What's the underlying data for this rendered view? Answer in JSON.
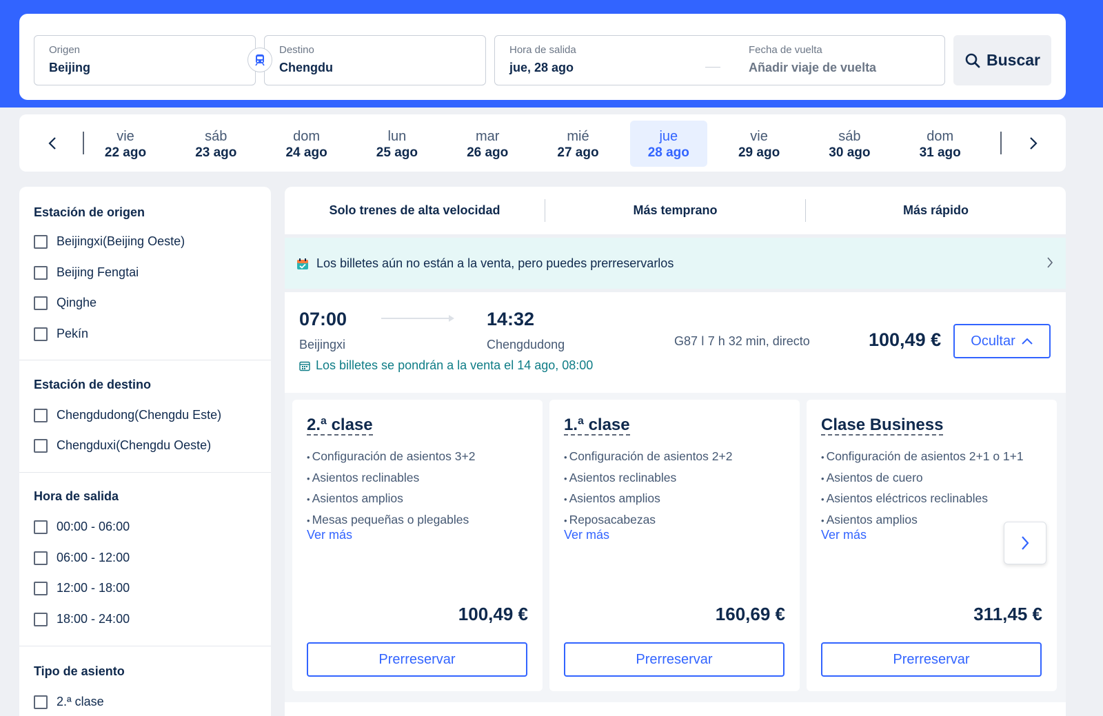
{
  "search": {
    "origin_label": "Origen",
    "origin_value": "Beijing",
    "destination_label": "Destino",
    "destination_value": "Chengdu",
    "departure_label": "Hora de salida",
    "departure_value": "jue, 28 ago",
    "return_label": "Fecha de vuelta",
    "return_value": "Añadir viaje de vuelta",
    "search_button": "Buscar",
    "swap_icon": "train-icon",
    "search_icon": "search-icon"
  },
  "date_strip": {
    "dates": [
      {
        "dow": "vie",
        "dm": "22 ago"
      },
      {
        "dow": "sáb",
        "dm": "23 ago"
      },
      {
        "dow": "dom",
        "dm": "24 ago"
      },
      {
        "dow": "lun",
        "dm": "25 ago"
      },
      {
        "dow": "mar",
        "dm": "26 ago"
      },
      {
        "dow": "mié",
        "dm": "27 ago"
      },
      {
        "dow": "jue",
        "dm": "28 ago"
      },
      {
        "dow": "vie",
        "dm": "29 ago"
      },
      {
        "dow": "sáb",
        "dm": "30 ago"
      },
      {
        "dow": "dom",
        "dm": "31 ago"
      }
    ],
    "selected_index": 6
  },
  "filters": {
    "origin_station": {
      "title": "Estación de origen",
      "options": [
        "Beijingxi(Beijing Oeste)",
        "Beijing Fengtai",
        "Qinghe",
        "Pekín"
      ]
    },
    "destination_station": {
      "title": "Estación de destino",
      "options": [
        "Chengdudong(Chengdu Este)",
        "Chengduxi(Chengdu Oeste)"
      ]
    },
    "departure_time": {
      "title": "Hora de salida",
      "options": [
        "00:00 - 06:00",
        "06:00 - 12:00",
        "12:00 - 18:00",
        "18:00 - 24:00"
      ]
    },
    "seat_type": {
      "title": "Tipo de asiento",
      "options": [
        "2.ª clase"
      ]
    }
  },
  "sort": {
    "options": [
      "Solo trenes de alta velocidad",
      "Más temprano",
      "Más rápido"
    ]
  },
  "notice": {
    "text": "Los billetes aún no están a la venta, pero puedes prerreservarlos"
  },
  "train": {
    "depart_time": "07:00",
    "depart_station": "Beijingxi",
    "arrive_time": "14:32",
    "arrive_station": "Chengdudong",
    "meta": "G87  ǀ  7 h 32 min, directo",
    "sale_note": "Los billetes se pondrán a la venta el 14 ago, 08:00",
    "price": "100,49 €",
    "hide_button": "Ocultar"
  },
  "classes": [
    {
      "name": "2.ª clase",
      "features": [
        "Configuración de asientos 3+2",
        "Asientos reclinables",
        "Asientos amplios",
        "Mesas pequeñas o plegables"
      ],
      "see_more": "Ver más",
      "price": "100,49 €",
      "button": "Prerreservar"
    },
    {
      "name": "1.ª clase",
      "features": [
        "Configuración de asientos 2+2",
        "Asientos reclinables",
        "Asientos amplios",
        "Reposacabezas"
      ],
      "see_more": "Ver más",
      "price": "160,69 €",
      "button": "Prerreservar"
    },
    {
      "name": "Clase Business",
      "features": [
        "Configuración de asientos 2+1 o 1+1",
        "Asientos de cuero",
        "Asientos eléctricos reclinables",
        "Asientos amplios"
      ],
      "see_more": "Ver más",
      "price": "311,45 €",
      "button": "Prerreservar"
    }
  ],
  "colors": {
    "brand_blue": "#3264ff",
    "dark_text": "#0f294d",
    "teal_note": "#0e7c86",
    "notice_bg": "#e6f7f7"
  }
}
